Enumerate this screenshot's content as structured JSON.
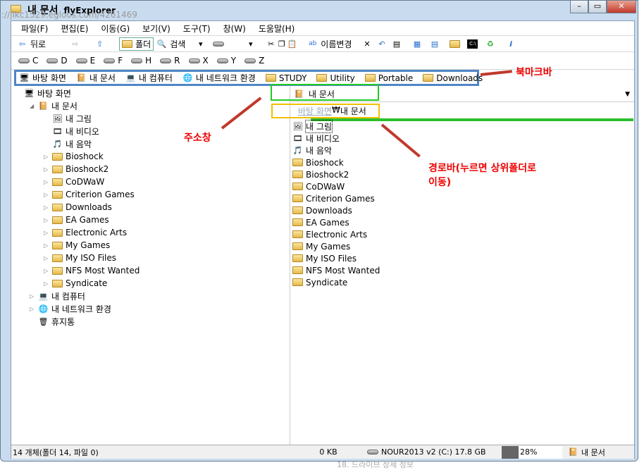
{
  "window": {
    "title": "내 문서",
    "app_name": "flyExplorer",
    "background_url_text": "://jikc1529.egloos.com/4261469",
    "controls": [
      "–",
      "▭",
      "✕"
    ]
  },
  "menu": [
    "파일(F)",
    "편집(E)",
    "이동(G)",
    "보기(V)",
    "도구(T)",
    "창(W)",
    "도움말(H)"
  ],
  "toolbar": {
    "back": "뒤로",
    "folder": "폴더",
    "search": "검색",
    "rename": "이름변경"
  },
  "drives": [
    "C",
    "D",
    "E",
    "F",
    "H",
    "R",
    "X",
    "Y",
    "Z"
  ],
  "bookmarks": [
    "바탕 화면",
    "내 문서",
    "내 컴퓨터",
    "내 네트워크 환경",
    "STUDY",
    "Utility",
    "Portable",
    "Downloads"
  ],
  "tree": [
    {
      "label": "바탕 화면",
      "level": 0
    },
    {
      "label": "내 문서",
      "level": 1
    },
    {
      "label": "내 그림",
      "level": 2
    },
    {
      "label": "내 비디오",
      "level": 2
    },
    {
      "label": "내 음악",
      "level": 2
    },
    {
      "label": "Bioshock",
      "level": 2
    },
    {
      "label": "Bioshock2",
      "level": 2
    },
    {
      "label": "CoDWaW",
      "level": 2
    },
    {
      "label": "Criterion Games",
      "level": 2
    },
    {
      "label": "Downloads",
      "level": 2
    },
    {
      "label": "EA Games",
      "level": 2
    },
    {
      "label": "Electronic Arts",
      "level": 2
    },
    {
      "label": "My Games",
      "level": 2
    },
    {
      "label": "My ISO Files",
      "level": 2
    },
    {
      "label": "NFS Most Wanted",
      "level": 2
    },
    {
      "label": "Syndicate",
      "level": 2
    },
    {
      "label": "내 컴퓨터",
      "level": 1
    },
    {
      "label": "내 네트워크 환경",
      "level": 1
    },
    {
      "label": "휴지통",
      "level": 1
    }
  ],
  "address": {
    "value": "내 문서"
  },
  "pathbar": {
    "parent": "바탕 화면",
    "sep": "₩",
    "current": "내 문서"
  },
  "files": [
    "내 그림",
    "내 비디오",
    "내 음악",
    "Bioshock",
    "Bioshock2",
    "CoDWaW",
    "Criterion Games",
    "Downloads",
    "EA Games",
    "Electronic Arts",
    "My Games",
    "My ISO Files",
    "NFS Most Wanted",
    "Syndicate"
  ],
  "status": {
    "count": "14 개체(폴더 14, 파일 0)",
    "size": "0 KB",
    "drive": "NOUR2013 v2 (C:) 17.8 GB",
    "usage": "28%",
    "usage_pct": 28,
    "location": "내 문서"
  },
  "annotations": {
    "bookmark": "북마크바",
    "address": "주소창",
    "pathbar": "경로바(누르면 상위폴더로",
    "pathbar2": "이동)"
  },
  "caption": "18. 드라이브 상세 정보",
  "colors": {
    "bookmark_box": "#4f86c6",
    "address_box": "#22cc22",
    "pathbar_box": "#f0c000",
    "annotation": "#e00000",
    "arrow": "#c0392b"
  }
}
